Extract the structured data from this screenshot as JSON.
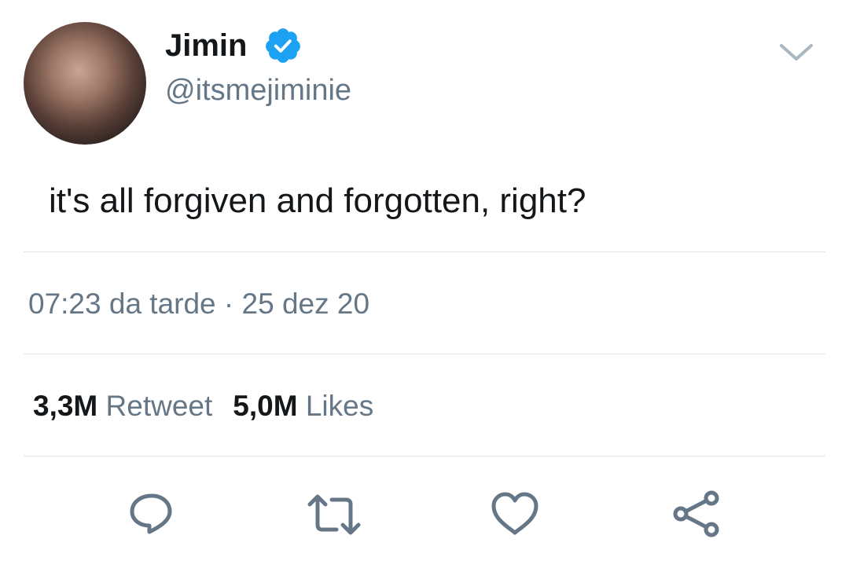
{
  "author": {
    "display_name": "Jimin",
    "handle": "@itsmejiminie",
    "verified": true
  },
  "tweet": {
    "text": "it's all forgiven and forgotten, right?",
    "time": "07:23 da tarde",
    "separator": "·",
    "date": "25 dez 20"
  },
  "stats": {
    "retweets_count": "3,3M",
    "retweets_label": "Retweet",
    "likes_count": "5,0M",
    "likes_label": "Likes"
  },
  "icons": {
    "verified": "verified-badge-icon",
    "menu": "chevron-down-icon",
    "reply": "reply-icon",
    "retweet": "retweet-icon",
    "like": "heart-icon",
    "share": "share-icon"
  },
  "colors": {
    "text_primary": "#14171a",
    "text_secondary": "#657786",
    "verified_blue": "#1da1f2",
    "divider": "#e1e8ed"
  }
}
